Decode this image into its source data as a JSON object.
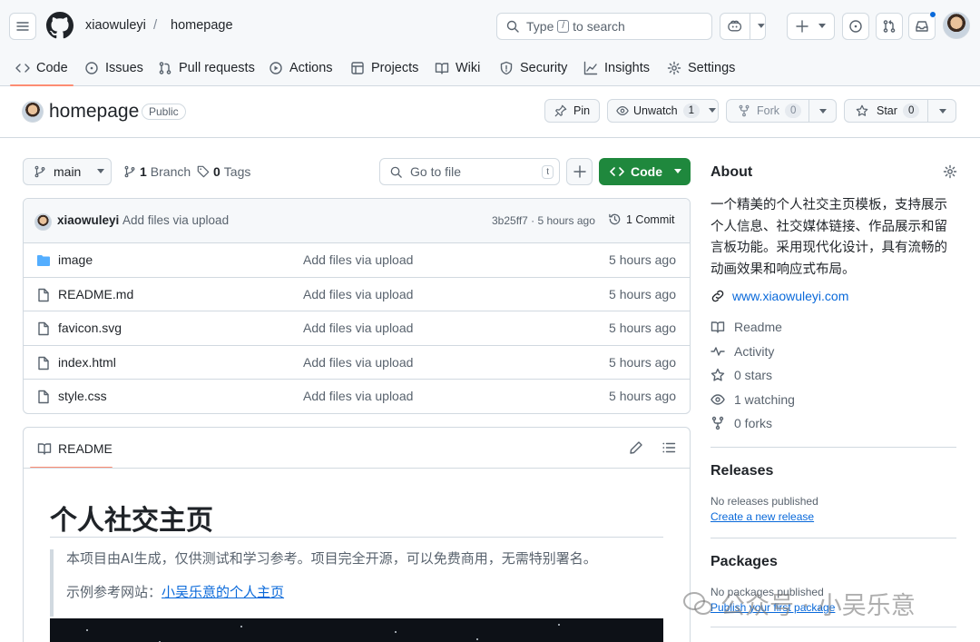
{
  "header": {
    "owner": "xiaowuleyi",
    "separator": "/",
    "repo": "homepage",
    "search_prefix": "Type",
    "search_key": "/",
    "search_suffix": "to search"
  },
  "nav": {
    "code": "Code",
    "issues": "Issues",
    "pulls": "Pull requests",
    "actions": "Actions",
    "projects": "Projects",
    "wiki": "Wiki",
    "security": "Security",
    "insights": "Insights",
    "settings": "Settings"
  },
  "repohead": {
    "title": "homepage",
    "visibility": "Public",
    "pin": "Pin",
    "unwatch": "Unwatch",
    "watch_count": "1",
    "fork": "Fork",
    "fork_count": "0",
    "star": "Star",
    "star_count": "0"
  },
  "branchbar": {
    "branch": "main",
    "branch_count": "1",
    "branch_label": "Branch",
    "tag_count": "0",
    "tag_label": "Tags",
    "goto_placeholder": "Go to file",
    "goto_key": "t",
    "code_label": "Code"
  },
  "commit": {
    "user": "xiaowuleyi",
    "message": "Add files via upload",
    "hash_time": "3b25ff7 · 5 hours ago",
    "commits": "1 Commit"
  },
  "files": [
    {
      "name": "image",
      "type": "folder",
      "message": "Add files via upload",
      "age": "5 hours ago"
    },
    {
      "name": "README.md",
      "type": "file",
      "message": "Add files via upload",
      "age": "5 hours ago"
    },
    {
      "name": "favicon.svg",
      "type": "file",
      "message": "Add files via upload",
      "age": "5 hours ago"
    },
    {
      "name": "index.html",
      "type": "file",
      "message": "Add files via upload",
      "age": "5 hours ago"
    },
    {
      "name": "style.css",
      "type": "file",
      "message": "Add files via upload",
      "age": "5 hours ago"
    }
  ],
  "readme": {
    "tab": "README",
    "heading": "个人社交主页",
    "quote_line1": "本项目由AI生成，仅供测试和学习参考。项目完全开源，可以免费商用，无需特别署名。",
    "quote_line2_prefix": "示例参考网站：",
    "quote_line2_link": "小吴乐意的个人主页"
  },
  "about": {
    "title": "About",
    "description": "一个精美的个人社交主页模板，支持展示个人信息、社交媒体链接、作品展示和留言板功能。采用现代化设计，具有流畅的动画效果和响应式布局。",
    "website": "www.xiaowuleyi.com",
    "readme": "Readme",
    "activity": "Activity",
    "stars": "0 stars",
    "watching": "1 watching",
    "forks": "0 forks"
  },
  "releases": {
    "title": "Releases",
    "none": "No releases published",
    "create": "Create a new release"
  },
  "packages": {
    "title": "Packages",
    "none": "No packages published",
    "publish": "Publish your first package"
  },
  "watermark": "公众号 · 小吴乐意",
  "colors": {
    "accent_green": "#1f883d",
    "link_blue": "#0969da",
    "tab_underline": "#fd8c73",
    "folder_blue": "#54aeff"
  }
}
